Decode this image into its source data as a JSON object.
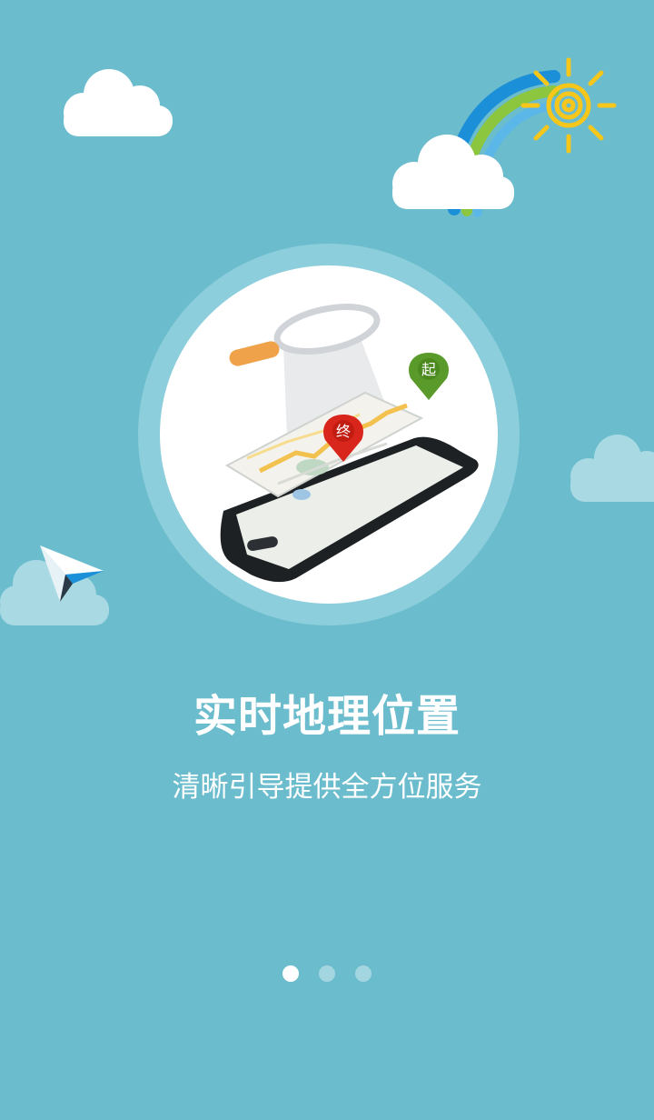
{
  "onboarding": {
    "title": "实时地理位置",
    "subtitle": "清晰引导提供全方位服务",
    "pin_start_label": "起",
    "pin_end_label": "终",
    "page_indicator": {
      "total": 3,
      "active_index": 0
    }
  },
  "colors": {
    "background": "#6bbccd",
    "dot_active": "#ffffff",
    "dot_inactive": "#a3d6e0",
    "pin_start": "#5a9a2a",
    "pin_end": "#d9261c",
    "sun": "#f7c61a"
  },
  "icons": [
    "cloud-icon",
    "rainbow-icon",
    "sun-icon",
    "paper-plane-icon",
    "magnifier-icon",
    "map-pin-icon",
    "smartphone-icon"
  ]
}
